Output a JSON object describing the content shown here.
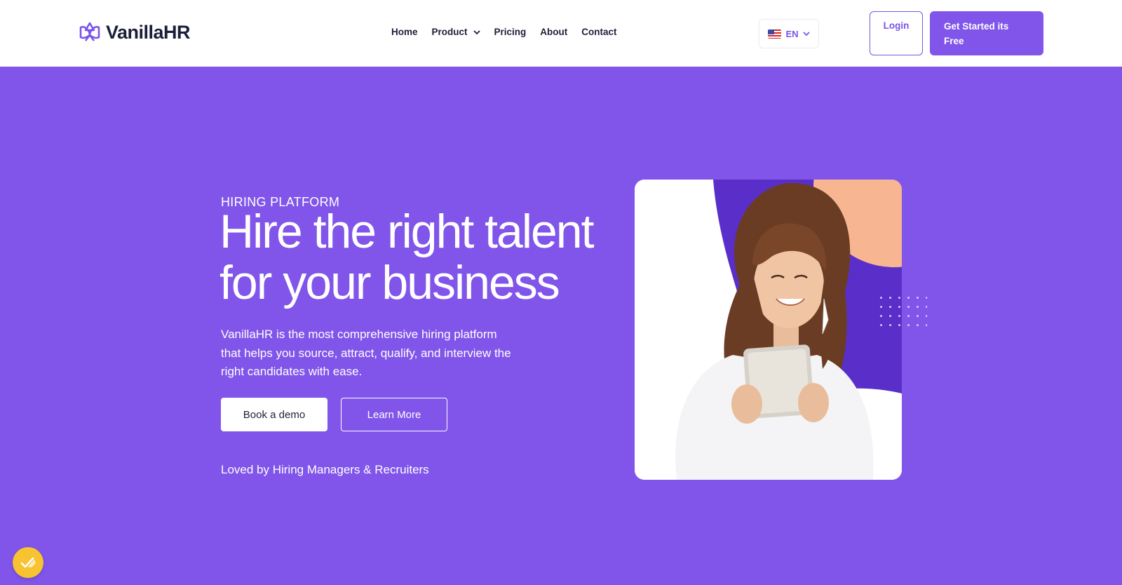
{
  "brand": {
    "name": "VanillaHR",
    "logo_icon": "knot-logo-icon",
    "accent": "#8155ea",
    "background": "#8155ea"
  },
  "nav": {
    "items": [
      {
        "label": "Home"
      },
      {
        "label": "Product",
        "icon": "chevron-down-icon"
      },
      {
        "label": "Pricing"
      },
      {
        "label": "About"
      },
      {
        "label": "Contact"
      }
    ]
  },
  "language": {
    "code": "EN",
    "flag": "us-flag-icon"
  },
  "header_actions": {
    "login_label": "Login",
    "cta_label": "Get Started its Free"
  },
  "hero": {
    "eyebrow": "HIRING PLATFORM",
    "title_line1": "Hire the right talent",
    "title_line2": "for your business",
    "description": "VanillaHR is the most comprehensive hiring platform that helps you source, attract, qualify, and interview the right candidates with ease.",
    "primary_button": "Book a demo",
    "secondary_button": "Learn More",
    "social_proof": "Loved by Hiring Managers & Recruiters",
    "image": "woman-holding-tablet-photo"
  },
  "floating_badge": {
    "icon": "check-badge-icon",
    "color": "#f7c331"
  }
}
